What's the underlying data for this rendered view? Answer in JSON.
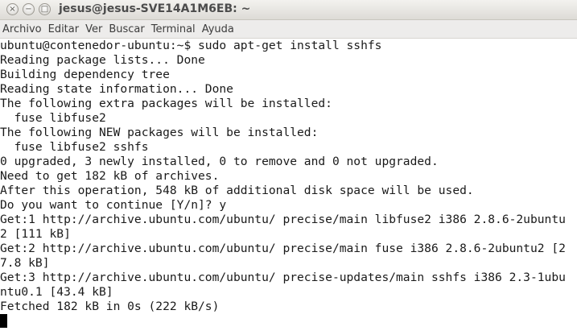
{
  "window": {
    "title": "jesus@jesus-SVE14A1M6EB: ~",
    "buttons": {
      "close": "×",
      "minimize": "−",
      "maximize": "□"
    }
  },
  "menu": {
    "items": [
      "Archivo",
      "Editar",
      "Ver",
      "Buscar",
      "Terminal",
      "Ayuda"
    ]
  },
  "terminal": {
    "lines": [
      "ubuntu@contenedor-ubuntu:~$ sudo apt-get install sshfs",
      "Reading package lists... Done",
      "Building dependency tree",
      "Reading state information... Done",
      "The following extra packages will be installed:",
      "  fuse libfuse2",
      "The following NEW packages will be installed:",
      "  fuse libfuse2 sshfs",
      "0 upgraded, 3 newly installed, 0 to remove and 0 not upgraded.",
      "Need to get 182 kB of archives.",
      "After this operation, 548 kB of additional disk space will be used.",
      "Do you want to continue [Y/n]? y",
      "Get:1 http://archive.ubuntu.com/ubuntu/ precise/main libfuse2 i386 2.8.6-2ubuntu",
      "2 [111 kB]",
      "Get:2 http://archive.ubuntu.com/ubuntu/ precise/main fuse i386 2.8.6-2ubuntu2 [2",
      "7.8 kB]",
      "Get:3 http://archive.ubuntu.com/ubuntu/ precise-updates/main sshfs i386 2.3-1ubu",
      "ntu0.1 [43.4 kB]",
      "Fetched 182 kB in 0s (222 kB/s)",
      ""
    ]
  }
}
